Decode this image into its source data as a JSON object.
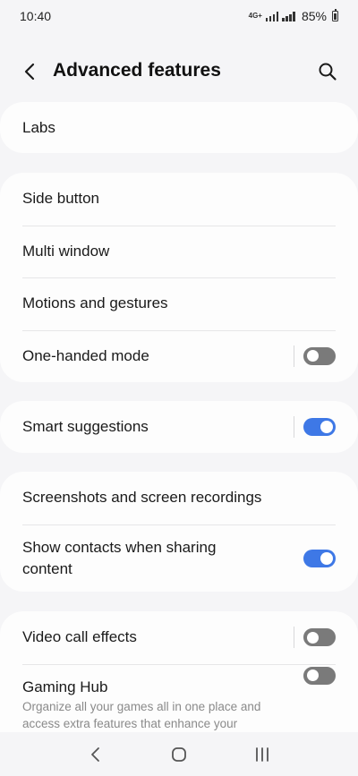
{
  "status_bar": {
    "time": "10:40",
    "network_type": "4G+",
    "battery": "85%"
  },
  "header": {
    "title": "Advanced features",
    "back_icon": "chevron-left-icon",
    "search_icon": "search-icon"
  },
  "sections": [
    {
      "items": [
        {
          "label": "Labs"
        }
      ]
    },
    {
      "items": [
        {
          "label": "Side button"
        },
        {
          "label": "Multi window"
        },
        {
          "label": "Motions and gestures"
        },
        {
          "label": "One-handed mode",
          "toggle": "off"
        }
      ]
    },
    {
      "items": [
        {
          "label": "Smart suggestions",
          "toggle": "on"
        }
      ]
    },
    {
      "items": [
        {
          "label": "Screenshots and screen recordings"
        },
        {
          "label": "Show contacts when sharing content",
          "toggle": "on"
        }
      ]
    },
    {
      "items": [
        {
          "label": "Video call effects",
          "toggle": "off"
        },
        {
          "label": "Gaming Hub",
          "subtext": "Organize all your games all in one place and access extra features that enhance your",
          "toggle": "off"
        }
      ]
    }
  ],
  "colors": {
    "accent": "#3e78e6",
    "background": "#f5f5f7",
    "card": "#fdfdfd"
  },
  "nav_bar": {
    "back_icon": "nav-back-icon",
    "home_icon": "nav-home-icon",
    "recents_icon": "nav-recents-icon"
  }
}
